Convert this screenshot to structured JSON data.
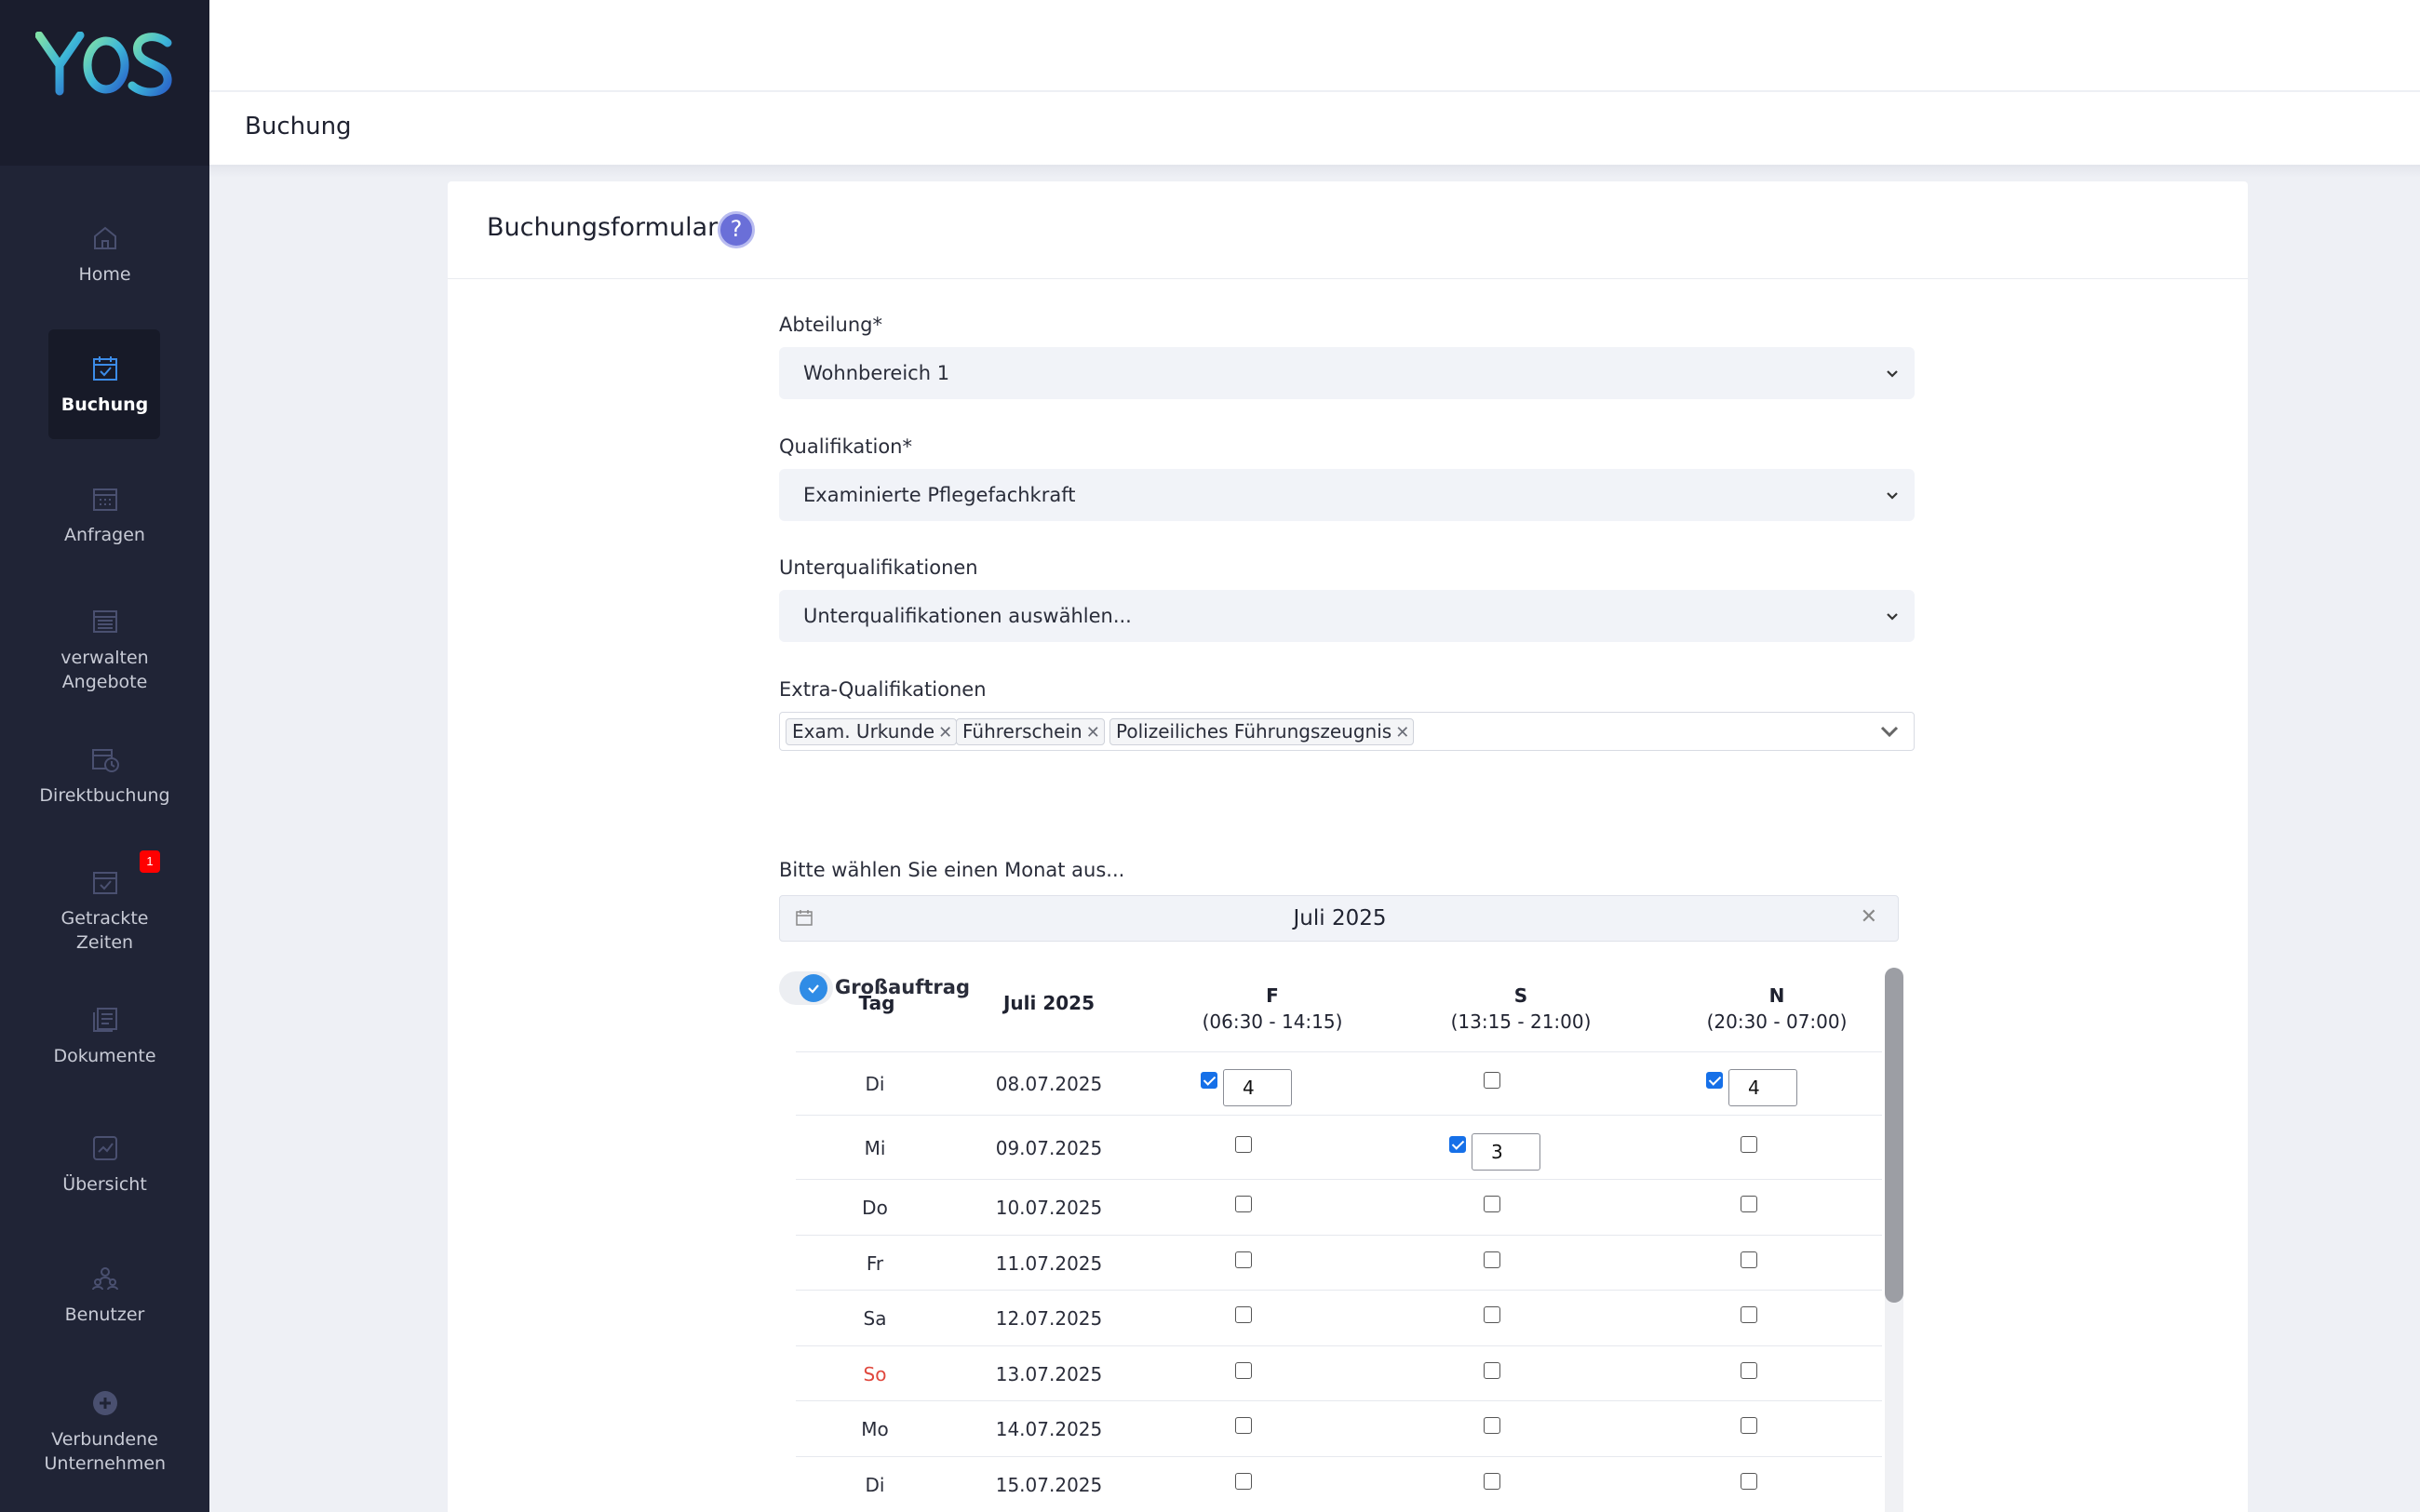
{
  "colors": {
    "sidebar_bg": "#202436",
    "accent_blue": "#1670e8",
    "help_icon": "#6a6fd8",
    "badge_red": "#ff0000",
    "sunday_red": "#e0483e"
  },
  "sidebar": {
    "logo_text": "YOS",
    "items": [
      {
        "label": "Home",
        "icon": "home-icon"
      },
      {
        "label": "Buchung",
        "icon": "calendar-check-icon"
      },
      {
        "label": "Anfragen",
        "icon": "calendar-grid-icon"
      },
      {
        "label": "verwalten Angebote",
        "icon": "manage-offers-icon"
      },
      {
        "label": "Direktbuchung",
        "icon": "calendar-clock-icon"
      },
      {
        "label": "Getrackte Zeiten",
        "icon": "tracked-times-icon",
        "badge": "1"
      },
      {
        "label": "Dokumente",
        "icon": "documents-icon"
      },
      {
        "label": "Übersicht",
        "icon": "overview-icon"
      },
      {
        "label": "Benutzer",
        "icon": "users-icon"
      },
      {
        "label": "Verbundene Unternehmen",
        "icon": "plus-circle-icon"
      }
    ]
  },
  "page": {
    "title": "Buchung"
  },
  "form": {
    "title": "Buchungsformular",
    "help": "?",
    "abteilung": {
      "label": "Abteilung*",
      "value": "Wohnbereich 1"
    },
    "qualifikation": {
      "label": "Qualifikation*",
      "value": "Examinierte Pflegefachkraft"
    },
    "unterqualifikationen": {
      "label": "Unterqualifikationen",
      "placeholder": "Unterqualifikationen auswählen..."
    },
    "extra": {
      "label": "Extra-Qualifikationen",
      "chips": [
        "Exam. Urkunde",
        "Führerschein",
        "Polizeiliches Führungszeugnis"
      ],
      "remove": "✕"
    },
    "grossauftrag": {
      "label": "Großauftrag",
      "checked": true
    },
    "month": {
      "label": "Bitte wählen Sie einen Monat aus...",
      "value": "Juli 2025",
      "clear": "✕"
    }
  },
  "table": {
    "headers": {
      "day": "Tag",
      "date": "Juli 2025",
      "f": {
        "name": "F",
        "time": "(06:30 - 14:15)"
      },
      "s": {
        "name": "S",
        "time": "(13:15 - 21:00)"
      },
      "n": {
        "name": "N",
        "time": "(20:30 - 07:00)"
      }
    },
    "rows": [
      {
        "day": "Di",
        "date": "08.07.2025",
        "f": true,
        "f_qty": "4",
        "s": false,
        "s_qty": "",
        "n": true,
        "n_qty": "4"
      },
      {
        "day": "Mi",
        "date": "09.07.2025",
        "f": false,
        "f_qty": "",
        "s": true,
        "s_qty": "3",
        "n": false,
        "n_qty": ""
      },
      {
        "day": "Do",
        "date": "10.07.2025",
        "f": false,
        "f_qty": "",
        "s": false,
        "s_qty": "",
        "n": false,
        "n_qty": ""
      },
      {
        "day": "Fr",
        "date": "11.07.2025",
        "f": false,
        "f_qty": "",
        "s": false,
        "s_qty": "",
        "n": false,
        "n_qty": ""
      },
      {
        "day": "Sa",
        "date": "12.07.2025",
        "f": false,
        "f_qty": "",
        "s": false,
        "s_qty": "",
        "n": false,
        "n_qty": ""
      },
      {
        "day": "So",
        "date": "13.07.2025",
        "f": false,
        "f_qty": "",
        "s": false,
        "s_qty": "",
        "n": false,
        "n_qty": ""
      },
      {
        "day": "Mo",
        "date": "14.07.2025",
        "f": false,
        "f_qty": "",
        "s": false,
        "s_qty": "",
        "n": false,
        "n_qty": ""
      },
      {
        "day": "Di",
        "date": "15.07.2025",
        "f": false,
        "f_qty": "",
        "s": false,
        "s_qty": "",
        "n": false,
        "n_qty": ""
      }
    ]
  }
}
